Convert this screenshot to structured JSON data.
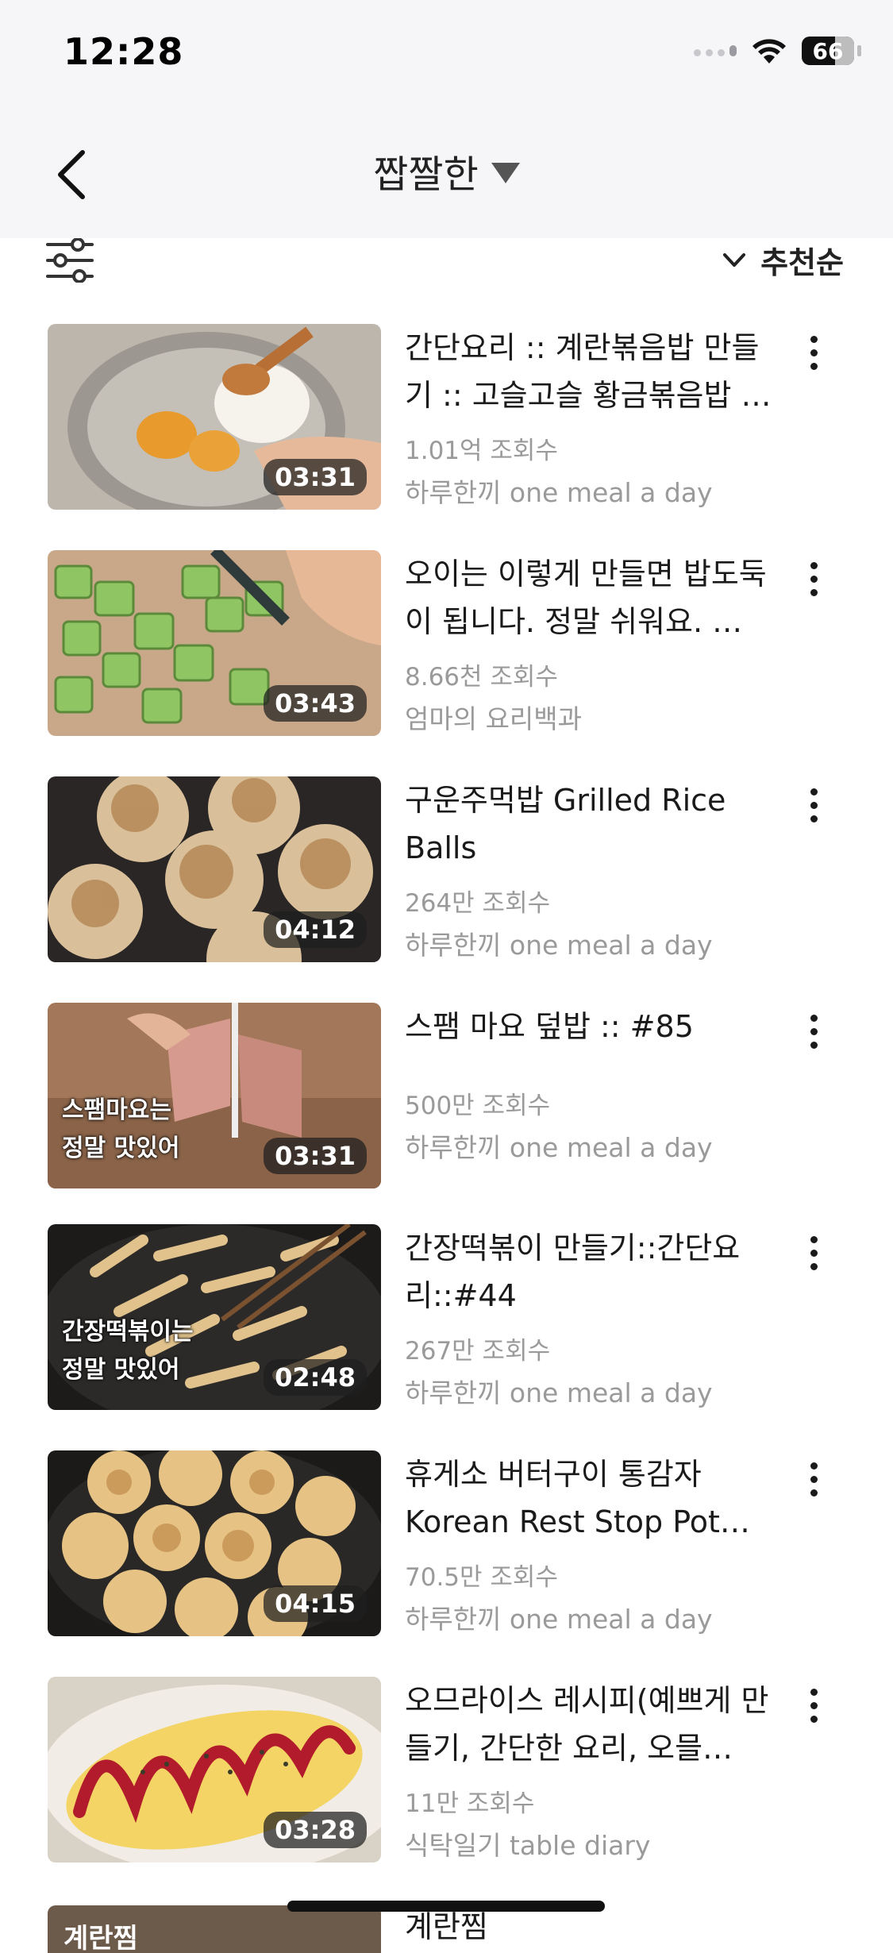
{
  "status_bar": {
    "time": "12:28",
    "battery": "66"
  },
  "header": {
    "title": "짭짤한"
  },
  "filter": {
    "sort_label": "추천순"
  },
  "videos": [
    {
      "title": "간단요리 :: 계란볶음밥 만들기 :: 고슬고슬 황금볶음밥 …",
      "views": "1.01억 조회수",
      "channel": "하루한끼 one meal a day",
      "duration": "03:31",
      "caption": ""
    },
    {
      "title": "오이는 이렇게 만들면 밥도둑이 됩니다. 정말 쉬워요. …",
      "views": "8.66천 조회수",
      "channel": "엄마의 요리백과",
      "duration": "03:43",
      "caption": ""
    },
    {
      "title": "구운주먹밥 Grilled Rice Balls",
      "views": "264만 조회수",
      "channel": "하루한끼 one meal a day",
      "duration": "04:12",
      "caption": ""
    },
    {
      "title": "스팸 마요 덮밥 :: #85",
      "views": "500만 조회수",
      "channel": "하루한끼 one meal a day",
      "duration": "03:31",
      "caption_line1": "스팸마요는",
      "caption_line2": "정말 맛있어"
    },
    {
      "title": "간장떡볶이 만들기::간단요리::#44",
      "views": "267만 조회수",
      "channel": "하루한끼 one meal a day",
      "duration": "02:48",
      "caption_line1": "간장떡볶이는",
      "caption_line2": "정말 맛있어"
    },
    {
      "title": "휴게소 버터구이 통감자 Korean Rest Stop Pot…",
      "views": "70.5만 조회수",
      "channel": "하루한끼 one meal a day",
      "duration": "04:15",
      "caption": ""
    },
    {
      "title": "오므라이스 레시피(예쁘게 만들기, 간단한 요리, 오믈…",
      "views": "11만 조회수",
      "channel": "식탁일기 table diary",
      "duration": "03:28",
      "caption": ""
    }
  ],
  "partial_item": {
    "title": "계란찜",
    "thumb_text": "계란찜"
  },
  "colors": {
    "header_bg": "#f6f6f8",
    "secondary_text": "#9a9a9a",
    "duration_bg": "rgba(30,30,30,0.72)"
  },
  "icons": {
    "back": "chevron-left-icon",
    "title_dropdown": "caret-down-icon",
    "filter": "sliders-icon",
    "sort": "chevron-down-icon",
    "more": "more-vertical-icon"
  }
}
